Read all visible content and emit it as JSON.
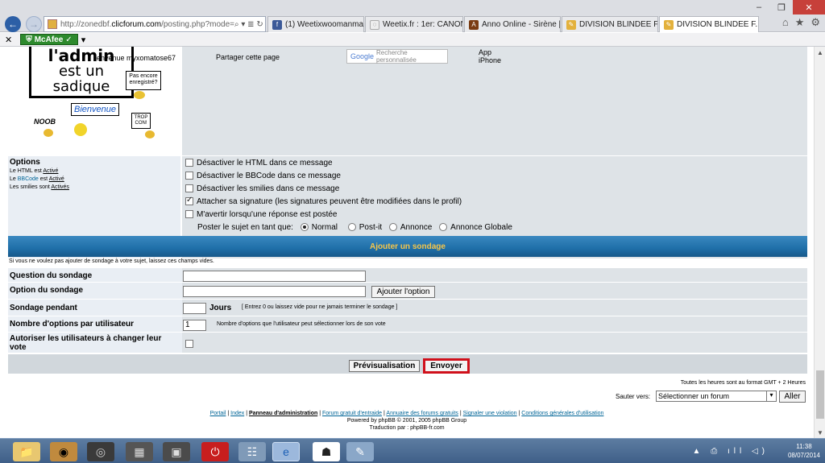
{
  "browser": {
    "url_prefix": "http://zonedbf.",
    "url_domain": "clicforum.com",
    "url_path": "/posting.php?mode=",
    "addr_controls": "⌕ ▾ ≣ ↻",
    "tabs": [
      {
        "label": "(1) Weetixwoomanman",
        "icon_color": "#3b5998",
        "icon": "f"
      },
      {
        "label": "Weetix.fr : 1er: CANON ...",
        "icon_color": "#e9e9e9",
        "icon": "◌"
      },
      {
        "label": "Anno Online - Sirène [R...",
        "icon_color": "#7a3b12",
        "icon": "A"
      },
      {
        "label": "DIVISION BLINDEE FRA...",
        "icon_color": "#e3b13c",
        "icon": "✎"
      },
      {
        "label": "DIVISION BLINDEE F...",
        "icon_color": "#e3b13c",
        "icon": "✎",
        "active": true
      }
    ],
    "window_controls": {
      "minimize": "–",
      "maximize": "❐",
      "close": "✕"
    },
    "tools": {
      "home": "⌂",
      "favorites": "★",
      "settings": "⚙"
    }
  },
  "addon_bar": {
    "close": "✕",
    "mcafee_label": "McAfee",
    "mcafee_check": "✓",
    "dropdown": "▾"
  },
  "header_row": {
    "admin_line1": "l'admin",
    "admin_line2": "est un",
    "admin_line3": "sadique",
    "welcome_text": "envenue myxomatose67",
    "sign_not_registered": "Pas encore enregistré?",
    "bienvenue": "Bienvenue",
    "noob": "NOOB",
    "trop_con": "TROP CON!",
    "share_label": "Partager cette page",
    "search_brand": "Google",
    "search_placeholder": "Recherche personnalisée",
    "app_label_1": "App",
    "app_label_2": "iPhone"
  },
  "options": {
    "title": "Options",
    "html_prefix": "Le HTML est",
    "html_state": "Activé",
    "bbcode_prefix": "Le",
    "bbcode_link": "BBCode",
    "bbcode_mid": "est",
    "bbcode_state": "Activé",
    "smilies_prefix": "Les smilies sont",
    "smilies_state": "Activés",
    "checkboxes": [
      {
        "label": "Désactiver le HTML dans ce message",
        "checked": false
      },
      {
        "label": "Désactiver le BBCode dans ce message",
        "checked": false
      },
      {
        "label": "Désactiver les smilies dans ce message",
        "checked": false
      },
      {
        "label": "Attacher sa signature (les signatures peuvent être modifiées dans le profil)",
        "checked": true
      },
      {
        "label": "M'avertir lorsqu'une réponse est postée",
        "checked": false
      }
    ],
    "post_type_label": "Poster le sujet en tant que:",
    "post_types": [
      {
        "label": "Normal",
        "selected": true
      },
      {
        "label": "Post-it",
        "selected": false
      },
      {
        "label": "Annonce",
        "selected": false
      },
      {
        "label": "Annonce Globale",
        "selected": false
      }
    ]
  },
  "poll": {
    "header": "Ajouter un sondage",
    "note": "Si vous ne voulez pas ajouter de sondage à votre sujet, laissez ces champs vides.",
    "question_label": "Question du sondage",
    "question_value": "",
    "option_label": "Option du sondage",
    "option_value": "",
    "add_option_button": "Ajouter l'option",
    "duration_label": "Sondage pendant",
    "duration_value": "",
    "days_label": "Jours",
    "duration_hint": "[ Entrez 0 ou laissez vide pour ne jamais terminer le sondage ]",
    "max_options_label": "Nombre d'options par utilisateur",
    "max_options_value": "1",
    "max_options_hint": "Nombre d'options que l'utilisateur peut sélectionner lors de son vote",
    "allow_change_label_1": "Autoriser les utilisateurs à changer leur",
    "allow_change_label_2": "vote"
  },
  "actions": {
    "preview": "Prévisualisation",
    "submit": "Envoyer",
    "submit_highlight": "#d0101b"
  },
  "footer": {
    "timezone": "Toutes les heures sont au format GMT + 2 Heures",
    "jump_label": "Sauter vers:",
    "jump_select": "Sélectionner un forum",
    "jump_button": "Aller",
    "links": [
      "Portail",
      "Index",
      "Panneau d'administration",
      "Forum gratuit d'entraide",
      "Annuaire des forums gratuits",
      "Signaler une violation",
      "Conditions générales d'utilisation"
    ],
    "powered": "Powered by phpBB © 2001, 2005 phpBB Group",
    "translation": "Traduction par : phpBB-fr.com"
  },
  "taskbar": {
    "time": "11:38",
    "date": "08/07/2014",
    "tray_icons": "▲ ⎙ ıll ◁)"
  },
  "colors": {
    "poll_header_bg": "#1f6fa8",
    "poll_header_text": "#f7c64a",
    "cell_light": "#e9eef4",
    "cell_dark": "#dee3e7"
  }
}
